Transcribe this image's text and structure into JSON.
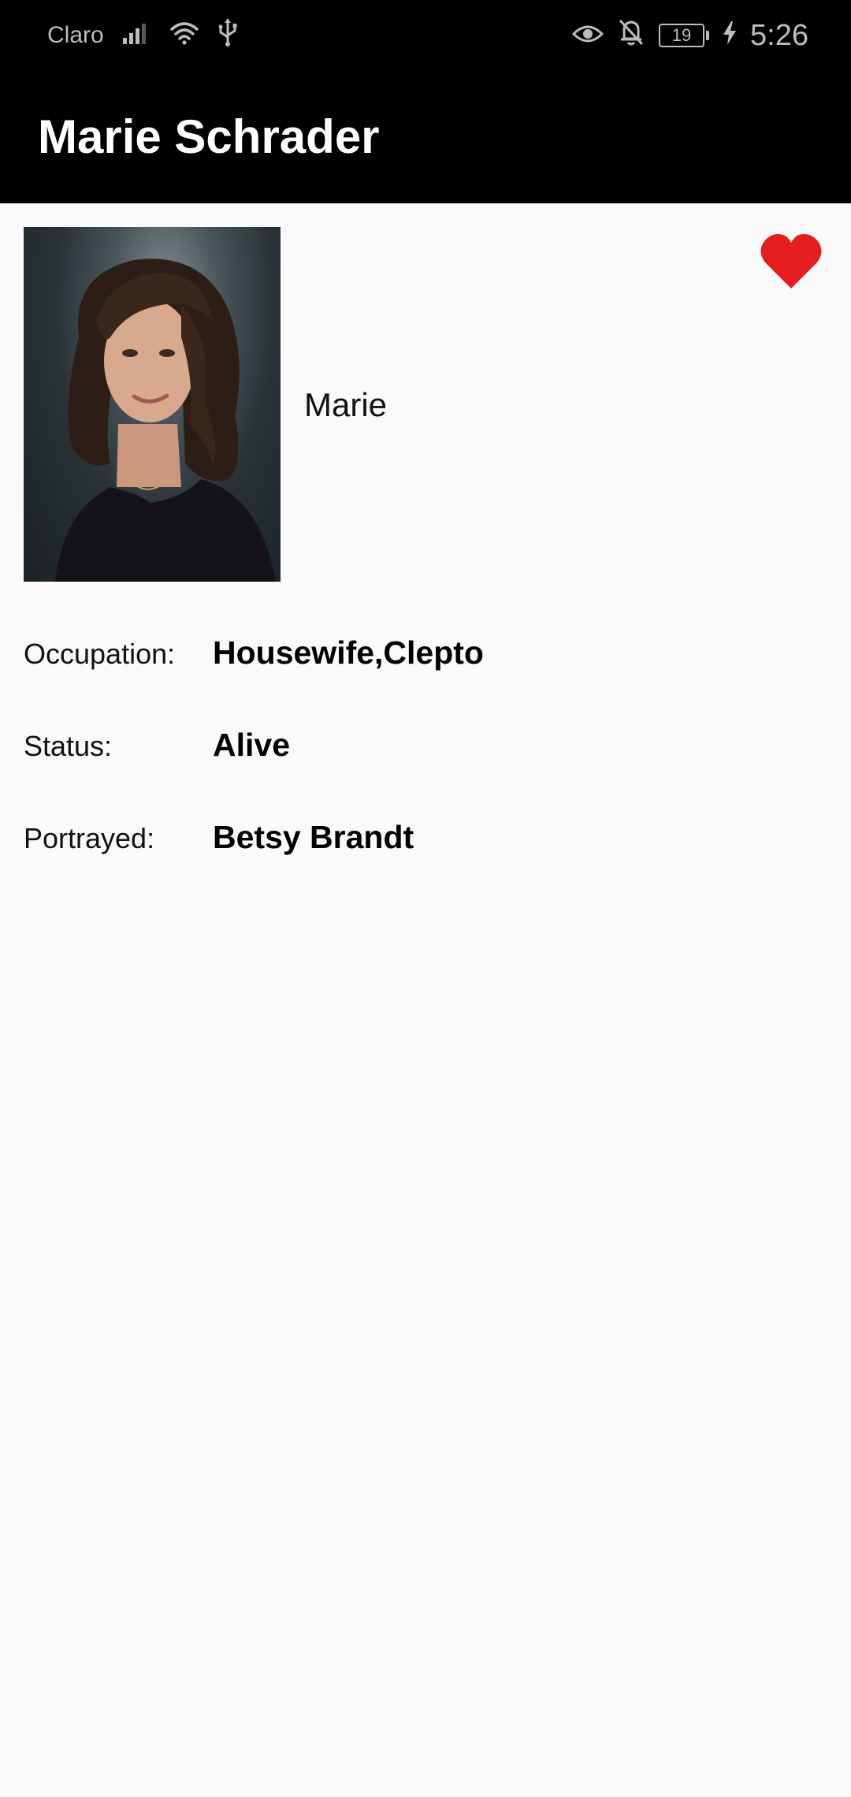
{
  "status_bar": {
    "carrier": "Claro",
    "battery_level": "19",
    "time": "5:26",
    "icons": [
      "signal-icon",
      "wifi-icon",
      "usb-icon",
      "eye-icon",
      "bell-off-icon",
      "battery-icon",
      "charging-icon"
    ]
  },
  "app_bar": {
    "title": "Marie Schrader"
  },
  "character": {
    "nickname": "Marie",
    "favorite_icon": "heart-icon",
    "favorite_color": "#e41e1e",
    "details": [
      {
        "label": "Occupation:",
        "value": "Housewife,Clepto"
      },
      {
        "label": "Status:",
        "value": "Alive"
      },
      {
        "label": "Portrayed:",
        "value": "Betsy Brandt"
      }
    ]
  }
}
